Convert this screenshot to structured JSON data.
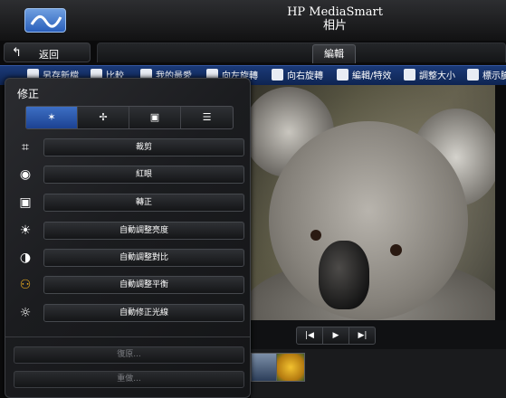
{
  "app": {
    "title_line1": "HP MediaSmart",
    "title_line2": "相片",
    "logo_icon": "wave-logo-icon"
  },
  "nav": {
    "back_label": "返回",
    "active_tab": "編輯"
  },
  "toolbar": {
    "items": [
      {
        "label": "另存新檔",
        "icon": "save-as-icon"
      },
      {
        "label": "比較",
        "icon": "compare-icon"
      },
      {
        "label": "我的最愛",
        "icon": "star-icon"
      },
      {
        "label": "向左旋轉",
        "icon": "rotate-left-icon"
      },
      {
        "label": "向右旋轉",
        "icon": "rotate-right-icon"
      },
      {
        "label": "編輯/特效",
        "icon": "wand-icon"
      },
      {
        "label": "調整大小",
        "icon": "resize-icon"
      },
      {
        "label": "標示臉",
        "icon": "face-tag-icon"
      }
    ]
  },
  "panel": {
    "title": "修正",
    "modes": [
      {
        "icon": "wand-icon",
        "active": true
      },
      {
        "icon": "crop-adjust-icon",
        "active": false
      },
      {
        "icon": "frame-icon",
        "active": false
      },
      {
        "icon": "list-icon",
        "active": false
      }
    ],
    "commands": [
      {
        "label": "裁剪",
        "icon": "crop-icon",
        "glyph": "⌗"
      },
      {
        "label": "紅眼",
        "icon": "eye-icon",
        "glyph": "◉"
      },
      {
        "label": "轉正",
        "icon": "portrait-icon",
        "glyph": "▣"
      },
      {
        "label": "自動調整亮度",
        "icon": "sun-icon",
        "glyph": "☀"
      },
      {
        "label": "自動調整對比",
        "icon": "contrast-icon",
        "glyph": "◑"
      },
      {
        "label": "自動調整平衡",
        "icon": "people-icon",
        "glyph": "⚇"
      },
      {
        "label": "自動修正光線",
        "icon": "light-icon",
        "glyph": "☼"
      }
    ],
    "restore_label": "復原...",
    "redo_label": "重做..."
  },
  "viewer": {
    "nav_buttons": [
      {
        "glyph": "|◀",
        "icon": "first-icon"
      },
      {
        "glyph": "▶",
        "icon": "play-icon"
      },
      {
        "glyph": "▶|",
        "icon": "last-icon"
      }
    ]
  },
  "colors": {
    "accent": "#1c4292",
    "toolbar": "#1b3a78"
  }
}
